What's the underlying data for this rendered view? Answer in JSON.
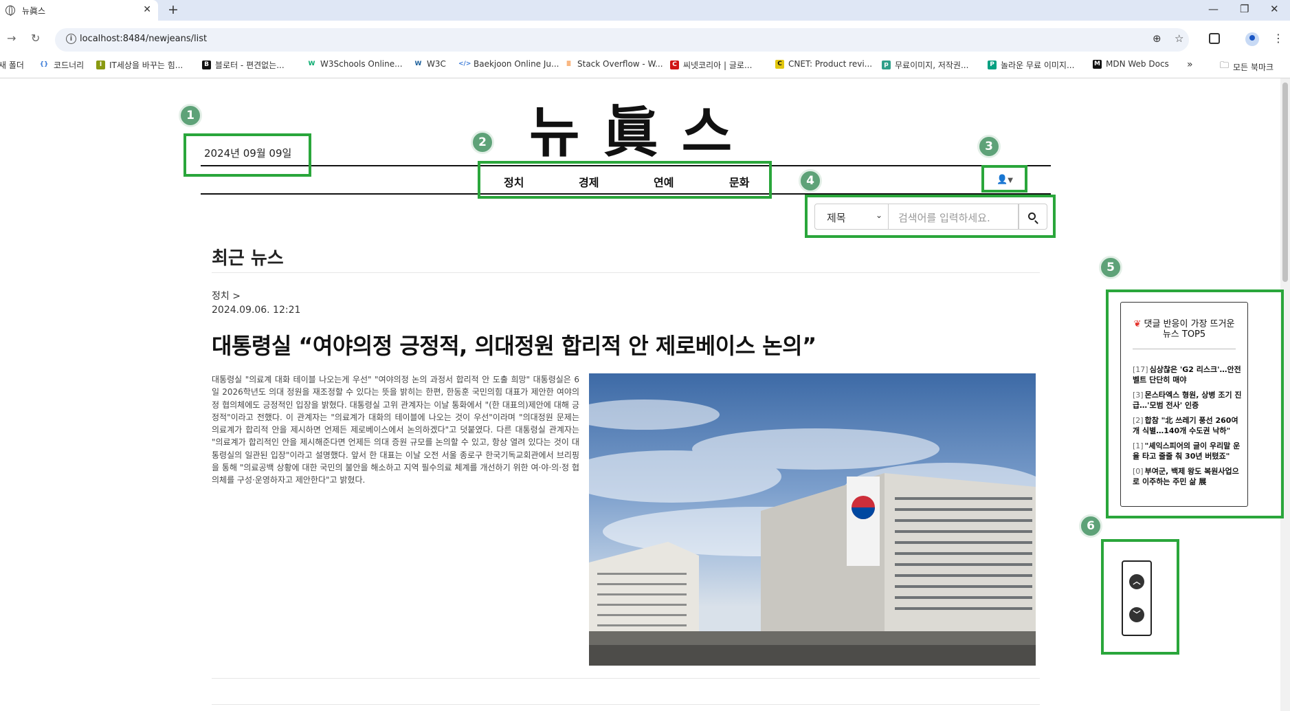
{
  "browser": {
    "tab_title": "뉴眞스",
    "url": "localhost:8484/newjeans/list",
    "bookmarks": [
      {
        "label": "새 폴더",
        "icon": "folder-icon",
        "color": "#555"
      },
      {
        "label": "코드너리",
        "icon": "braces-icon",
        "color": "#3b7bd8"
      },
      {
        "label": "IT세상을 바꾸는 힘...",
        "icon": "it-logo-icon",
        "color": "#8a9a12"
      },
      {
        "label": "블로터 - 편견없는...",
        "icon": "bloter-logo-icon",
        "color": "#111"
      },
      {
        "label": "W3Schools Online...",
        "icon": "w3schools-logo-icon",
        "color": "#04aa6d"
      },
      {
        "label": "W3C",
        "icon": "w3c-logo-icon",
        "color": "#1a5e9a"
      },
      {
        "label": "Baekjoon Online Ju...",
        "icon": "baekjoon-logo-icon",
        "color": "#3b7bd8"
      },
      {
        "label": "Stack Overflow - W...",
        "icon": "stackoverflow-logo-icon",
        "color": "#f48024"
      },
      {
        "label": "씨넷코리아 | 글로...",
        "icon": "cnet-korea-logo-icon",
        "color": "#d01414"
      },
      {
        "label": "CNET: Product revi...",
        "icon": "cnet-logo-icon",
        "color": "#e2c70f"
      },
      {
        "label": "무료이미지, 저작권...",
        "icon": "pixabay-logo-icon",
        "color": "#2ea089"
      },
      {
        "label": "놀라운 무료 이미지...",
        "icon": "pexels-logo-icon",
        "color": "#05a081"
      },
      {
        "label": "MDN Web Docs",
        "icon": "mdn-logo-icon",
        "color": "#111"
      }
    ],
    "all_bookmarks": "모든 북마크"
  },
  "header": {
    "logo": "뉴眞스",
    "date": "2024년 09월 09일",
    "nav": [
      "정치",
      "경제",
      "연예",
      "문화"
    ]
  },
  "search": {
    "select_value": "제목",
    "placeholder": "검색어를 입력하세요."
  },
  "main": {
    "section_title": "최근 뉴스",
    "article": {
      "category": "정치 >",
      "timestamp": "2024.09.06. 12:21",
      "headline": "대통령실 “여야의정 긍정적, 의대정원 합리적 안 제로베이스 논의”",
      "body": "대통령실 \"의료계 대화 테이블 나오는게 우선\" \"여야의정 논의 과정서 합리적 안 도출 희망\" 대통령실은 6일 2026학년도 의대 정원을 재조정할 수 있다는 뜻을 밝히는 한편, 한동훈 국민의힘 대표가 제안한 여야의정 협의체에도 긍정적인 입장을 밝혔다. 대통령실 고위 관계자는 이날 통화에서 \"(한 대표의)제안에 대해 긍정적\"이라고 전했다. 이 관계자는 \"의료계가 대화의 테이블에 나오는 것이 우선\"이라며 \"의대정원 문제는 의료계가 합리적 안을 제시하면 언제든 제로베이스에서 논의하겠다\"고 덧붙였다. 다른 대통령실 관계자는 \"의료계가 합리적인 안을 제시해준다면 언제든 의대 증원 규모를 논의할 수 있고, 항상 열려 있다는 것이 대통령실의 일관된 입장\"이라고 설명했다. 앞서 한 대표는 이날 오전 서울 종로구 한국기독교회관에서 브리핑을 통해 \"의료공백 상황에 대한 국민의 불안을 해소하고 지역 필수의료 체계를 개선하기 위한 여·야·의·정 협의체를 구성·운영하자고 제안한다\"고 밝혔다."
    }
  },
  "sidebar": {
    "top5_title": "댓글 반응이 가장 뜨거운 뉴스 TOP5",
    "items": [
      {
        "count": "[17]",
        "title": "심상찮은 'G2 리스크'…안전벨트 단단히 매야"
      },
      {
        "count": "[3]",
        "title": "몬스타엑스 형원, 상병 조기 진급…'모범 전사' 인증"
      },
      {
        "count": "[2]",
        "title": "합참 \"北 쓰레기 풍선 260여개 식별…140개 수도권 낙하\""
      },
      {
        "count": "[1]",
        "title": "\"셰익스피어의 글이 우리말 운율 타고 줄줄 춰 30년 버텼죠\""
      },
      {
        "count": "[0]",
        "title": "부여군, 백제 왕도 복원사업으로 이주하는 주민 삶 展"
      }
    ]
  },
  "annotations": [
    "1",
    "2",
    "3",
    "4",
    "5",
    "6"
  ],
  "colors": {
    "highlight": "#2aa63b",
    "badge": "#5ea278"
  }
}
